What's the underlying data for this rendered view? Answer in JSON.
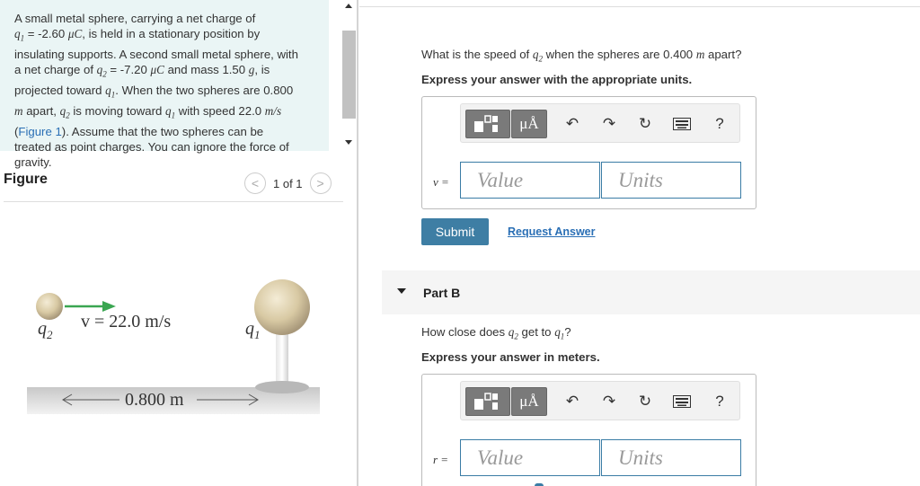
{
  "problem": {
    "l1": "A small metal sphere, carrying a net charge of",
    "l2_q1": "q",
    "l2_sub": "1",
    "l2_val": " = -2.60 ",
    "l2_unit": "μC",
    "l2_rest": ", is held in a stationary position by",
    "l3": "insulating supports. A second small metal sphere, with",
    "l4_a": "a net charge of ",
    "l4_q": "q",
    "l4_sub": "2",
    "l4_b": " = -7.20 ",
    "l4_unit": "μC",
    "l4_c": " and mass 1.50 ",
    "l4_g": "g",
    "l4_d": ", is",
    "l5_a": "projected toward ",
    "l5_q": "q",
    "l5_sub": "1",
    "l5_b": ". When the two spheres are 0.800",
    "l6_m": "m",
    "l6_a": " apart, ",
    "l6_q": "q",
    "l6_sub": "2",
    "l6_b": " is moving toward ",
    "l6_q2": "q",
    "l6_sub2": "1",
    "l6_c": " with speed 22.0 ",
    "l6_unit": "m/s",
    "l7_open": "(",
    "l7_link": "Figure 1",
    "l7_rest": "). Assume that the two spheres can be",
    "l8": "treated as point charges. You can ignore the force of",
    "l9": "gravity."
  },
  "figure": {
    "label": "Figure",
    "pager": "1 of 1",
    "prev": "<",
    "next": ">",
    "q2": "q",
    "q2_sub": "2",
    "v_label": "v = 22.0 m/s",
    "q1": "q",
    "q1_sub": "1",
    "distance": "0.800 m"
  },
  "partA": {
    "question_a": "What is the speed of ",
    "question_q": "q",
    "question_sub": "2",
    "question_b": " when the spheres are 0.400 ",
    "question_m": "m",
    "question_c": " apart?",
    "instruction": "Express your answer with the appropriate units.",
    "var": "v =",
    "value_placeholder": "Value",
    "units_placeholder": "Units",
    "mu_label": "μÅ",
    "help": "?",
    "submit": "Submit",
    "request": "Request Answer"
  },
  "partB": {
    "title": "Part B",
    "question_a": "How close does ",
    "question_q": "q",
    "question_sub": "2",
    "question_b": " get to ",
    "question_q2": "q",
    "question_sub2": "1",
    "question_c": "?",
    "instruction": "Express your answer in meters.",
    "var": "r =",
    "value_placeholder": "Value",
    "units_placeholder": "Units",
    "mu_label": "μÅ",
    "help": "?"
  },
  "colors": {
    "accent": "#3e7ea4",
    "problem_bg": "#eaf5f5",
    "link": "#2a6fb5",
    "arrow": "#3aa651"
  }
}
